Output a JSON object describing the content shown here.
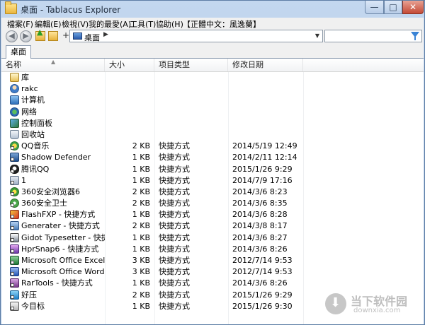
{
  "window": {
    "title": "桌面 - Tablacus Explorer",
    "min_glyph": "—",
    "max_glyph": "□",
    "close_glyph": "✕"
  },
  "menu": [
    "檔案(F)",
    "編輯(E)",
    "檢視(V)",
    "我的最愛(A)",
    "工具(T)",
    "協助(H)",
    "【正體中文：風逸蘭】"
  ],
  "toolbar": {
    "back_glyph": "◀",
    "forward_glyph": "▶",
    "plus": "+",
    "address": "桌面",
    "address_sep": "▶",
    "dropdown_glyph": "▼",
    "search_value": ""
  },
  "tabs": [
    {
      "label": "桌面"
    }
  ],
  "columns": {
    "name": "名称",
    "size": "大小",
    "type": "项目类型",
    "date": "修改日期"
  },
  "files": [
    {
      "name": "库",
      "size": "",
      "type": "",
      "date": "",
      "icon": "library-icon"
    },
    {
      "name": "rakc",
      "size": "",
      "type": "",
      "date": "",
      "icon": "user-folder-icon"
    },
    {
      "name": "计算机",
      "size": "",
      "type": "",
      "date": "",
      "icon": "computer-icon"
    },
    {
      "name": "网络",
      "size": "",
      "type": "",
      "date": "",
      "icon": "network-icon"
    },
    {
      "name": "控制面板",
      "size": "",
      "type": "",
      "date": "",
      "icon": "control-panel-icon"
    },
    {
      "name": "回收站",
      "size": "",
      "type": "",
      "date": "",
      "icon": "recycle-bin-icon"
    },
    {
      "name": "QQ音乐",
      "size": "2 KB",
      "type": "快捷方式",
      "date": "2014/5/19 12:49",
      "icon": "qq-music-icon"
    },
    {
      "name": "Shadow Defender",
      "size": "1 KB",
      "type": "快捷方式",
      "date": "2014/2/11 12:14",
      "icon": "shadow-defender-icon"
    },
    {
      "name": "腾讯QQ",
      "size": "1 KB",
      "type": "快捷方式",
      "date": "2015/1/26 9:29",
      "icon": "qq-icon"
    },
    {
      "name": "1",
      "size": "1 KB",
      "type": "快捷方式",
      "date": "2014/7/9 17:16",
      "icon": "app-icon"
    },
    {
      "name": "360安全浏览器6",
      "size": "2 KB",
      "type": "快捷方式",
      "date": "2014/3/6 8:23",
      "icon": "360-browser-icon"
    },
    {
      "name": "360安全卫士",
      "size": "2 KB",
      "type": "快捷方式",
      "date": "2014/3/6 8:35",
      "icon": "360-safe-icon"
    },
    {
      "name": "FlashFXP - 快捷方式",
      "size": "1 KB",
      "type": "快捷方式",
      "date": "2014/3/6 8:28",
      "icon": "flashfxp-icon"
    },
    {
      "name": "Generater - 快捷方式",
      "size": "2 KB",
      "type": "快捷方式",
      "date": "2014/3/8 8:17",
      "icon": "generater-icon"
    },
    {
      "name": "Gidot Typesetter - 快捷...",
      "size": "1 KB",
      "type": "快捷方式",
      "date": "2014/3/6 8:27",
      "icon": "gidot-icon"
    },
    {
      "name": "HprSnap6 - 快捷方式",
      "size": "1 KB",
      "type": "快捷方式",
      "date": "2014/3/6 8:26",
      "icon": "hypersnap-icon"
    },
    {
      "name": "Microsoft Office Excel 2...",
      "size": "3 KB",
      "type": "快捷方式",
      "date": "2012/7/14 9:53",
      "icon": "excel-icon"
    },
    {
      "name": "Microsoft Office Word ...",
      "size": "3 KB",
      "type": "快捷方式",
      "date": "2012/7/14 9:53",
      "icon": "word-icon"
    },
    {
      "name": "RarTools - 快捷方式",
      "size": "1 KB",
      "type": "快捷方式",
      "date": "2014/3/6 8:26",
      "icon": "rartools-icon"
    },
    {
      "name": "好压",
      "size": "2 KB",
      "type": "快捷方式",
      "date": "2015/1/26 9:29",
      "icon": "haozip-icon"
    },
    {
      "name": "今目标",
      "size": "1 KB",
      "type": "快捷方式",
      "date": "2015/1/26 9:30",
      "icon": "jinmubiao-icon"
    }
  ],
  "watermark": {
    "title": "当下软件园",
    "subtitle": "downxia.com"
  }
}
